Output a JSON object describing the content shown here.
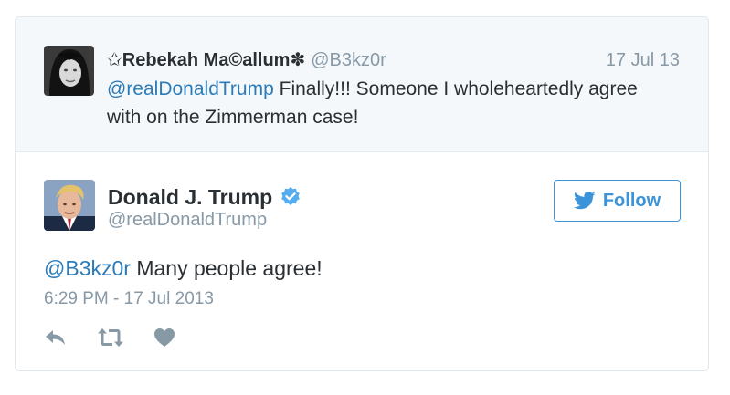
{
  "parent_tweet": {
    "display_name": "✩Rebekah Ma©allum✽",
    "handle": "@B3kz0r",
    "date": "17 Jul 13",
    "mention": "@realDonaldTrump",
    "text": " Finally!!! Someone I wholeheartedly agree with on the Zimmerman case!"
  },
  "main_tweet": {
    "display_name": "Donald J. Trump",
    "handle": "@realDonaldTrump",
    "mention": "@B3kz0r",
    "text": " Many people agree!",
    "timestamp": "6:29 PM - 17 Jul 2013"
  },
  "follow_button": {
    "label": "Follow"
  },
  "icons": {
    "verified": "verified-badge-icon",
    "follow": "twitter-bird-icon",
    "reply": "reply-icon",
    "retweet": "retweet-icon",
    "like": "heart-icon"
  },
  "colors": {
    "link_blue": "#2b7bb9",
    "follow_blue": "#3b94d9",
    "muted_gray": "#8899a6",
    "text_dark": "#292f33",
    "parent_bg": "#f5f8fa",
    "border": "#e1e8ed"
  }
}
